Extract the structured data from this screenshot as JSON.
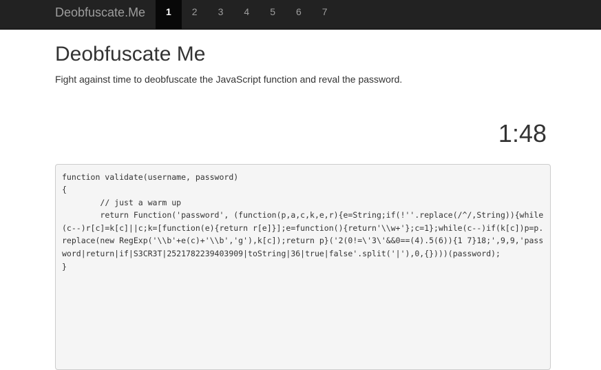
{
  "navbar": {
    "brand": "Deobfuscate.Me",
    "items": [
      {
        "label": "1",
        "active": true
      },
      {
        "label": "2",
        "active": false
      },
      {
        "label": "3",
        "active": false
      },
      {
        "label": "4",
        "active": false
      },
      {
        "label": "5",
        "active": false
      },
      {
        "label": "6",
        "active": false
      },
      {
        "label": "7",
        "active": false
      }
    ]
  },
  "main": {
    "title": "Deobfuscate Me",
    "lead": "Fight against time to deobfuscate the JavaScript function and reval the password.",
    "timer": "1:48"
  },
  "code": {
    "lines": [
      "function validate(username, password)",
      "{",
      "        // just a warm up",
      "        return Function('password', (function(p,a,c,k,e,r){e=String;if(!''.replace(/^/,String)){while(c--)r[c]=k[c]||c;k=[function(e){return r[e]}];e=function(){return'\\\\w+'};c=1};while(c--)if(k[c])p=p.replace(new RegExp('\\\\b'+e(c)+'\\\\b','g'),k[c]);return p}('2(0!=\\'3\\'&&0==(4).5(6)){1 7}18;',9,9,'password|return|if|S3CR3T|2521782239403909|toString|36|true|false'.split('|'),0,{})))(password);",
      "}"
    ]
  },
  "colors": {
    "navbar_bg": "#222222",
    "navbar_active_bg": "#080808",
    "navbar_text": "#9d9d9d",
    "code_bg": "#f5f5f5"
  }
}
